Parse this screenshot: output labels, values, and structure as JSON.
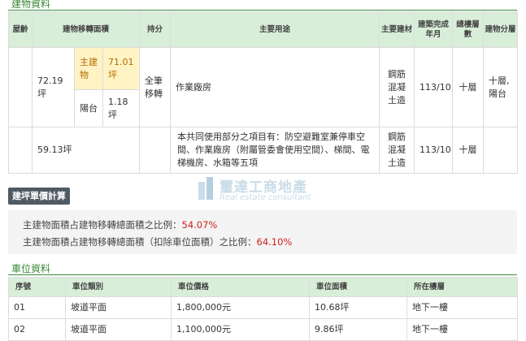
{
  "building": {
    "title": "建物資料",
    "headers": [
      "屋齡",
      "建物移轉面積",
      "持分",
      "主要用途",
      "主要建材",
      "建築完成年月",
      "總樓層數",
      "建物分層"
    ],
    "row1": {
      "area": "72.19坪",
      "main_label": "主建物",
      "main_value": "71.01坪",
      "balcony_label": "陽台",
      "balcony_value": "1.18坪",
      "share": "全筆移轉",
      "usage": "作業廠房",
      "material": "鋼筋混凝土造",
      "completed": "113/10",
      "floors": "十層",
      "level": "十層,陽台"
    },
    "row2": {
      "area": "59.13坪",
      "usage": "本共同使用部分之項目有：防空避難室兼停車空間、作業廠房（附屬管委會使用空間）、梯間、電梯機房、水箱等五項",
      "material": "鋼筋混凝土造",
      "completed": "113/10",
      "floors": "十層"
    }
  },
  "calc": {
    "button": "建坪單價計算",
    "line1_label": "主建物面積占建物移轉總面積之比例：",
    "line1_value": "54.07%",
    "line2_label": "主建物面積占建物移轉總面積（扣除車位面積）之比例：",
    "line2_value": "64.10%"
  },
  "watermark": {
    "text": "璽達工商地產",
    "sub": "Real estate consultant"
  },
  "parking": {
    "title": "車位資料",
    "headers": [
      "序號",
      "車位類別",
      "車位價格",
      "車位面積",
      "所在樓層"
    ],
    "rows": [
      {
        "no": "01",
        "type": "坡道平面",
        "price": "1,800,000元",
        "area": "10.68坪",
        "floor": "地下一樓"
      },
      {
        "no": "02",
        "type": "坡道平面",
        "price": "1,100,000元",
        "area": "9.86坪",
        "floor": "地下一樓"
      }
    ]
  },
  "colors": {
    "accent": "#3a8a3a",
    "header_bg": "#d9eed9",
    "highlight_bg": "#fff3c4",
    "ratio": "#d02020"
  }
}
